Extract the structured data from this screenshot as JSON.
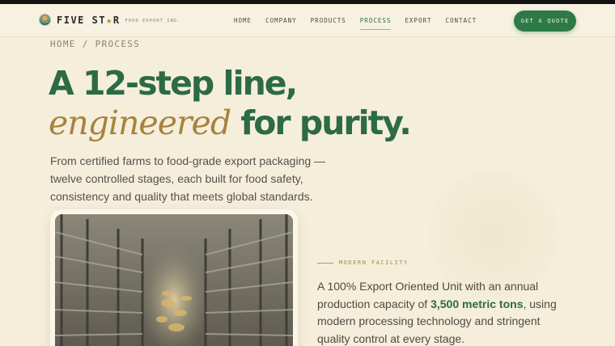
{
  "brand": {
    "name_pre": "FIVE ST",
    "name_star": "★",
    "name_post": "R",
    "tagline": "FOOD EXPORT IND."
  },
  "nav": {
    "items": [
      {
        "label": "HOME",
        "active": false
      },
      {
        "label": "COMPANY",
        "active": false
      },
      {
        "label": "PRODUCTS",
        "active": false
      },
      {
        "label": "PROCESS",
        "active": true
      },
      {
        "label": "EXPORT",
        "active": false
      },
      {
        "label": "CONTACT",
        "active": false
      }
    ],
    "cta": "GET A QUOTE"
  },
  "breadcrumb": {
    "home": "HOME",
    "separator": "/",
    "current": "PROCESS"
  },
  "hero": {
    "line1": "A 12-step line,",
    "line2_accent": "engineered",
    "line2_rest": " for purity.",
    "intro": "From certified farms to food-grade export packaging — twelve controlled stages, each built for food safety, consistency and quality that meets global standards."
  },
  "facility": {
    "eyebrow": "MODERN FACILITY",
    "text_before": "A 100% Export Oriented Unit with an annual production capacity of ",
    "text_highlight": "3,500 metric tons",
    "text_after": ", using modern processing technology and stringent quality control at every stage."
  },
  "colors": {
    "brand_green": "#2c6b43",
    "accent_gold": "#a8823d",
    "background": "#f5eedb"
  }
}
